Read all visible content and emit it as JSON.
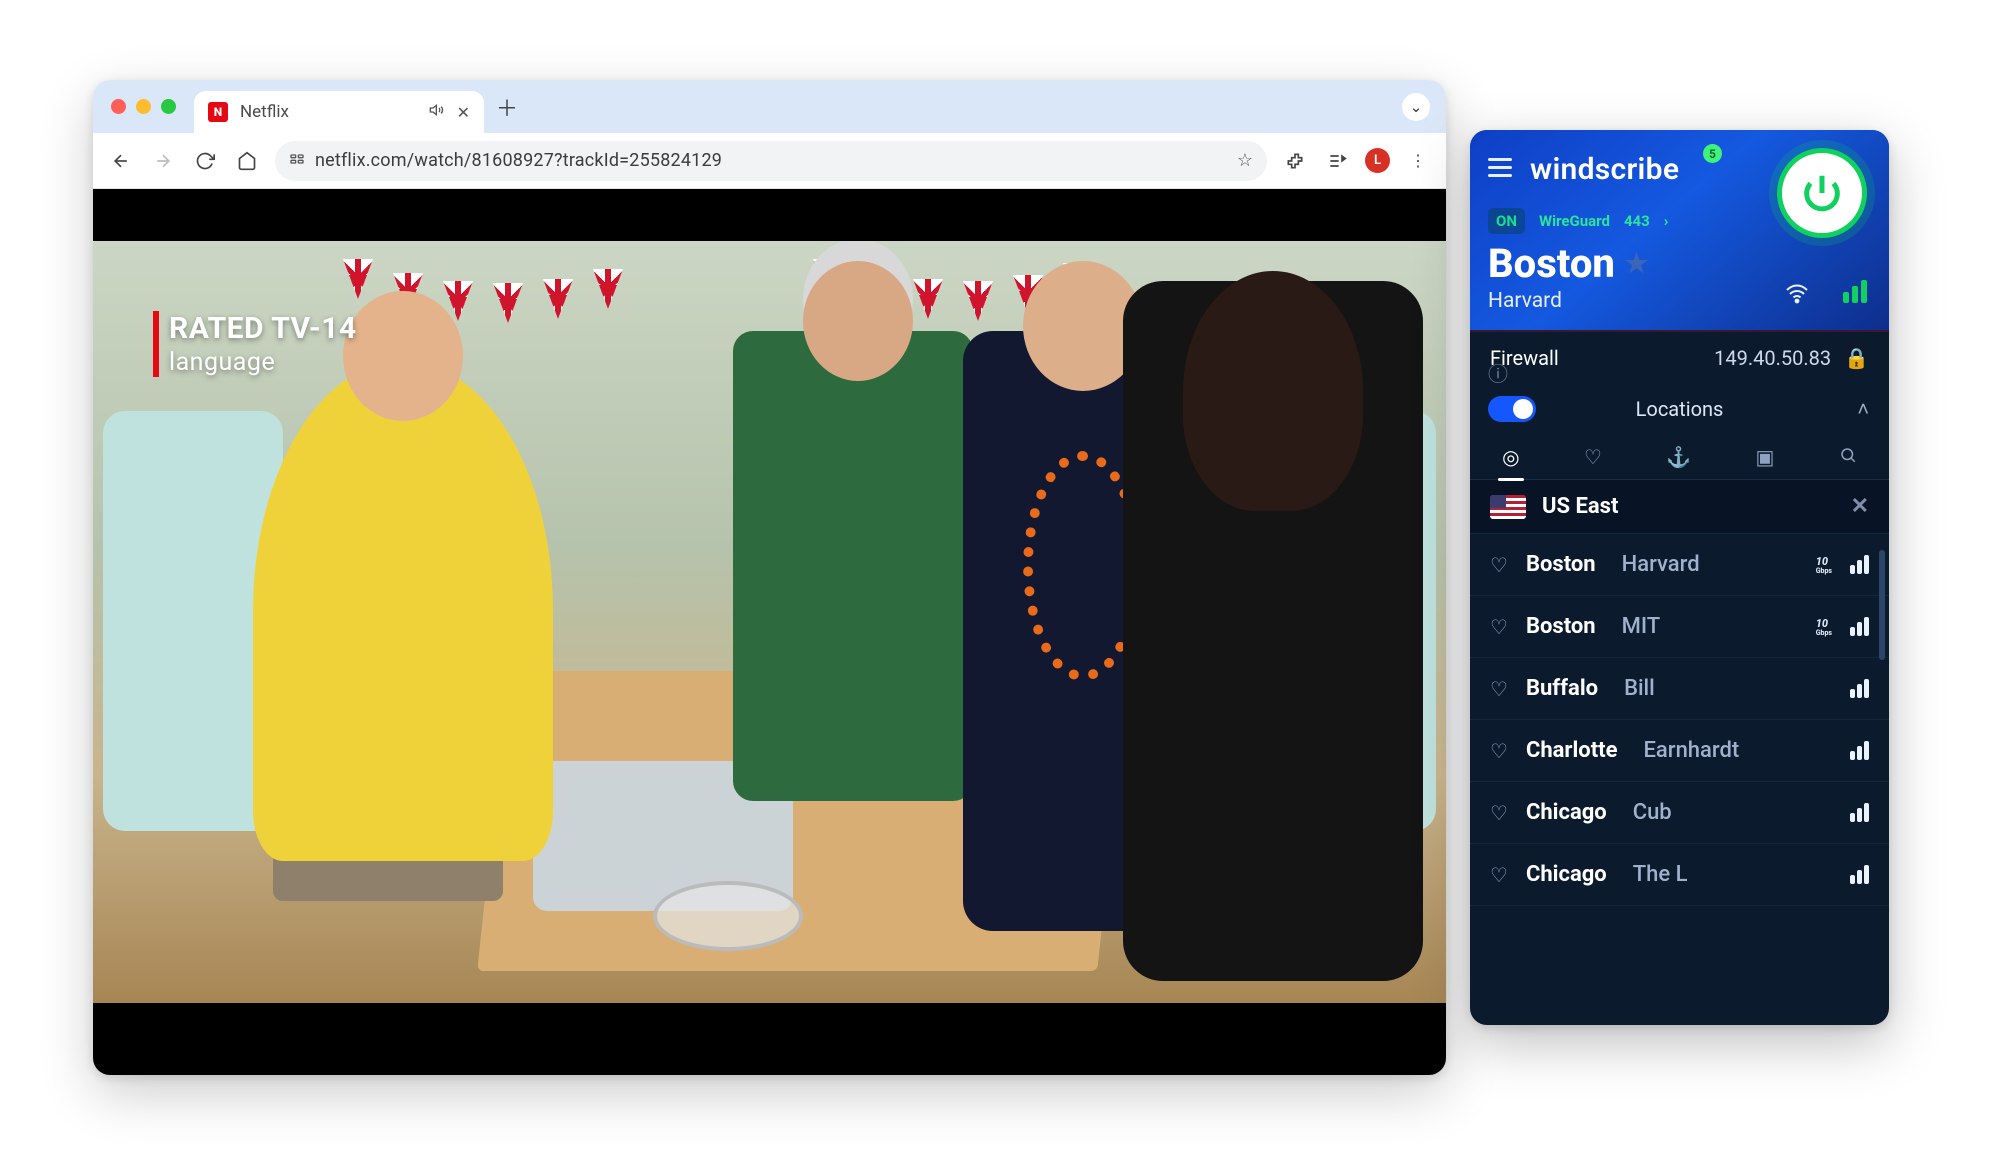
{
  "browser": {
    "tab_title": "Netflix",
    "url": "netflix.com/watch/81608927?trackId=255824129",
    "rating": "RATED TV-14",
    "rating_sub": "language",
    "profile_letter": "L"
  },
  "vpn": {
    "brand": "windscribe",
    "notif_count": "5",
    "status": "ON",
    "protocol": "WireGuard",
    "port": "443",
    "city": "Boston",
    "city_sub": "Harvard",
    "firewall_label": "Firewall",
    "ip": "149.40.50.83",
    "locations_label": "Locations",
    "group": "US East",
    "servers": [
      {
        "city": "Boston",
        "sub": "Harvard",
        "ten": true
      },
      {
        "city": "Boston",
        "sub": "MIT",
        "ten": true
      },
      {
        "city": "Buffalo",
        "sub": "Bill",
        "ten": false
      },
      {
        "city": "Charlotte",
        "sub": "Earnhardt",
        "ten": false
      },
      {
        "city": "Chicago",
        "sub": "Cub",
        "ten": false
      },
      {
        "city": "Chicago",
        "sub": "The L",
        "ten": false
      }
    ],
    "ten_label": "10"
  }
}
